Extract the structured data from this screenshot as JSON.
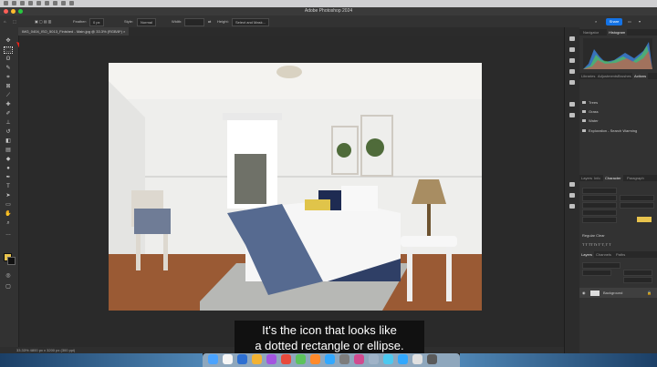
{
  "window": {
    "title": "Adobe Photoshop 2024",
    "traffic_colors": [
      "#fe5f57",
      "#febc2e",
      "#28c840"
    ]
  },
  "options": {
    "feather_label": "Feather:",
    "feather_value": "0 px",
    "style_label": "Style:",
    "style_value": "Normal",
    "width_label": "Width:",
    "height_label": "Height:",
    "select_mask_label": "Select and Mask...",
    "share_label": "Share"
  },
  "document": {
    "tab_label": "IMG_0404_ISO_5013_Finished - Main.jpg @ 33.3% (RGB/8*)",
    "status_text": "33.33%   4800 px x 3200 px (300 ppi)"
  },
  "annotation": {
    "arrow_color": "#e8221a"
  },
  "panels": {
    "top_tabs": [
      "Navigator",
      "Histogram"
    ],
    "mid_tabs": [
      "Libraries",
      "Adjustments",
      "Brushes",
      "Actions"
    ],
    "folders": [
      "Trees",
      "Grass",
      "Water",
      "Exploration - Search Warming"
    ],
    "props_tabs": [
      "Layers",
      "Info",
      "Character",
      "Paragraph"
    ],
    "font_name": "Regular Clear",
    "layers_tabs": [
      "Layers",
      "Channels",
      "Paths"
    ],
    "layer_name": "Background",
    "color_chip": "#e8c34d"
  },
  "caption": {
    "line1": "It's the icon that looks like",
    "line2": "a dotted rectangle or ellipse."
  },
  "dock": {
    "icon_colors": [
      "#4aa3ff",
      "#f5f5f5",
      "#2d6fd2",
      "#f2b233",
      "#a455e0",
      "#e84a3c",
      "#5cc35c",
      "#ff8a2b",
      "#31a8ff",
      "#7c7c7c",
      "#d14b8f",
      "#9fb3c8",
      "#4cc9f0",
      "#31a8ff",
      "#e0e0e0",
      "#5a5a5a"
    ]
  }
}
